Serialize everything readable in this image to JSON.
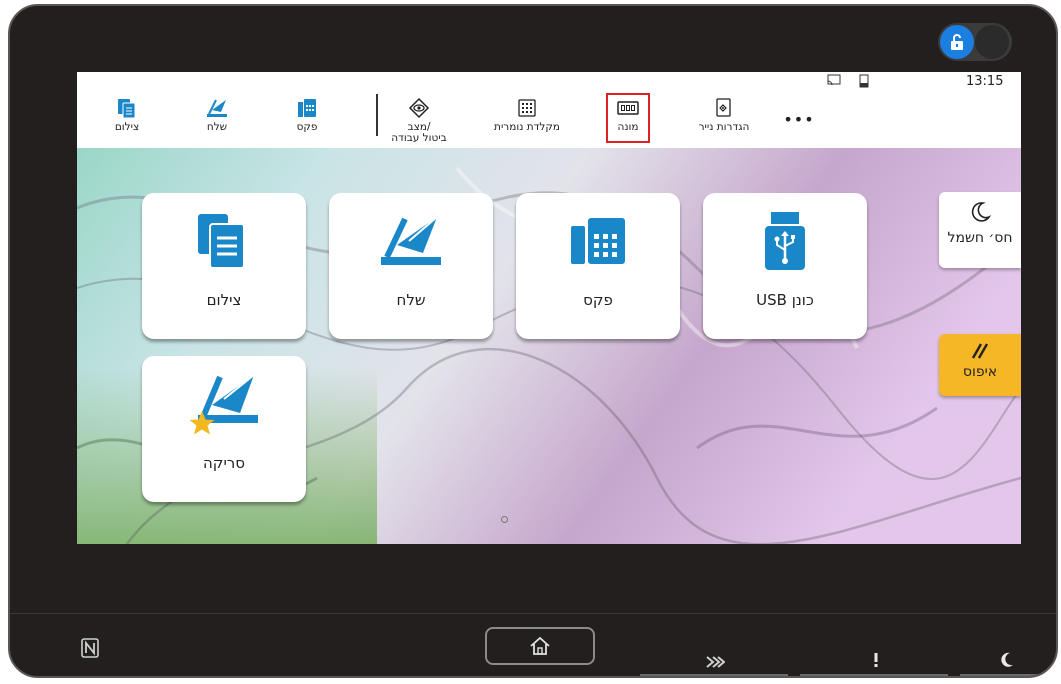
{
  "status_bar": {
    "time": "13:15"
  },
  "toolbar": {
    "items": [
      {
        "label": "צילום"
      },
      {
        "label": "שלח"
      },
      {
        "label": "פקס"
      },
      {
        "label_line1": "מצב/",
        "label_line2": "ביטול עבודה"
      },
      {
        "label": "מקלדת נומרית"
      },
      {
        "label": "מונה"
      },
      {
        "label": "הגדרות נייר"
      },
      {
        "label": "•••"
      }
    ]
  },
  "tiles": [
    {
      "label": "צילום"
    },
    {
      "label": "שלח"
    },
    {
      "label": "פקס"
    },
    {
      "label": "USB כונן"
    },
    {
      "label": "סריקה"
    }
  ],
  "side_buttons": {
    "energy_saver": {
      "label": "חס׳ חשמל"
    },
    "reset": {
      "label": "איפוס"
    }
  },
  "colors": {
    "accent_blue": "#1a7fe0",
    "icon_blue": "#1a87c8",
    "reset_yellow": "#f5b726",
    "highlight_red": "#e02020",
    "star_yellow": "#f4b81f"
  },
  "icons": [
    "nfc-icon",
    "home-icon",
    "fast-forward-icon",
    "alert-icon",
    "moon-icon",
    "lock-open-icon"
  ]
}
